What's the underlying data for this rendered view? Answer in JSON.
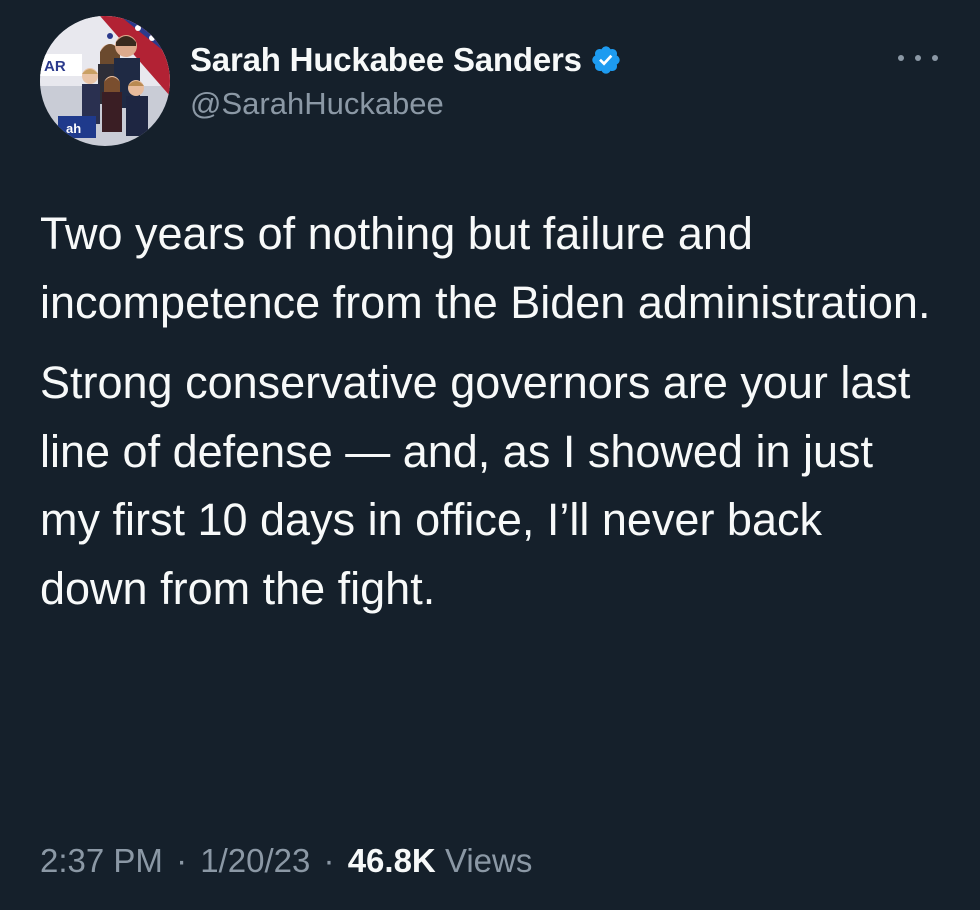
{
  "author": {
    "display_name": "Sarah Huckabee Sanders",
    "handle": "@SarahHuckabee",
    "verified": true,
    "avatar_sign_text": "AR",
    "avatar_placard_text": "ah"
  },
  "tweet": {
    "paragraphs": [
      "Two years of nothing but failure and incompetence from the Biden administration.",
      "Strong conservative governors are your last line of defense — and, as I showed in just my first 10 days in office, I’ll never back down from the fight."
    ]
  },
  "meta": {
    "time": "2:37 PM",
    "separator": "·",
    "date": "1/20/23",
    "views_count": "46.8K",
    "views_label": "Views"
  },
  "colors": {
    "background": "#15202b",
    "text_primary": "#f7f9f9",
    "text_secondary": "#8b98a5",
    "verified_badge": "#1d9bf0"
  },
  "icons": {
    "verified": "verified-badge-icon",
    "more": "more-options-icon"
  }
}
